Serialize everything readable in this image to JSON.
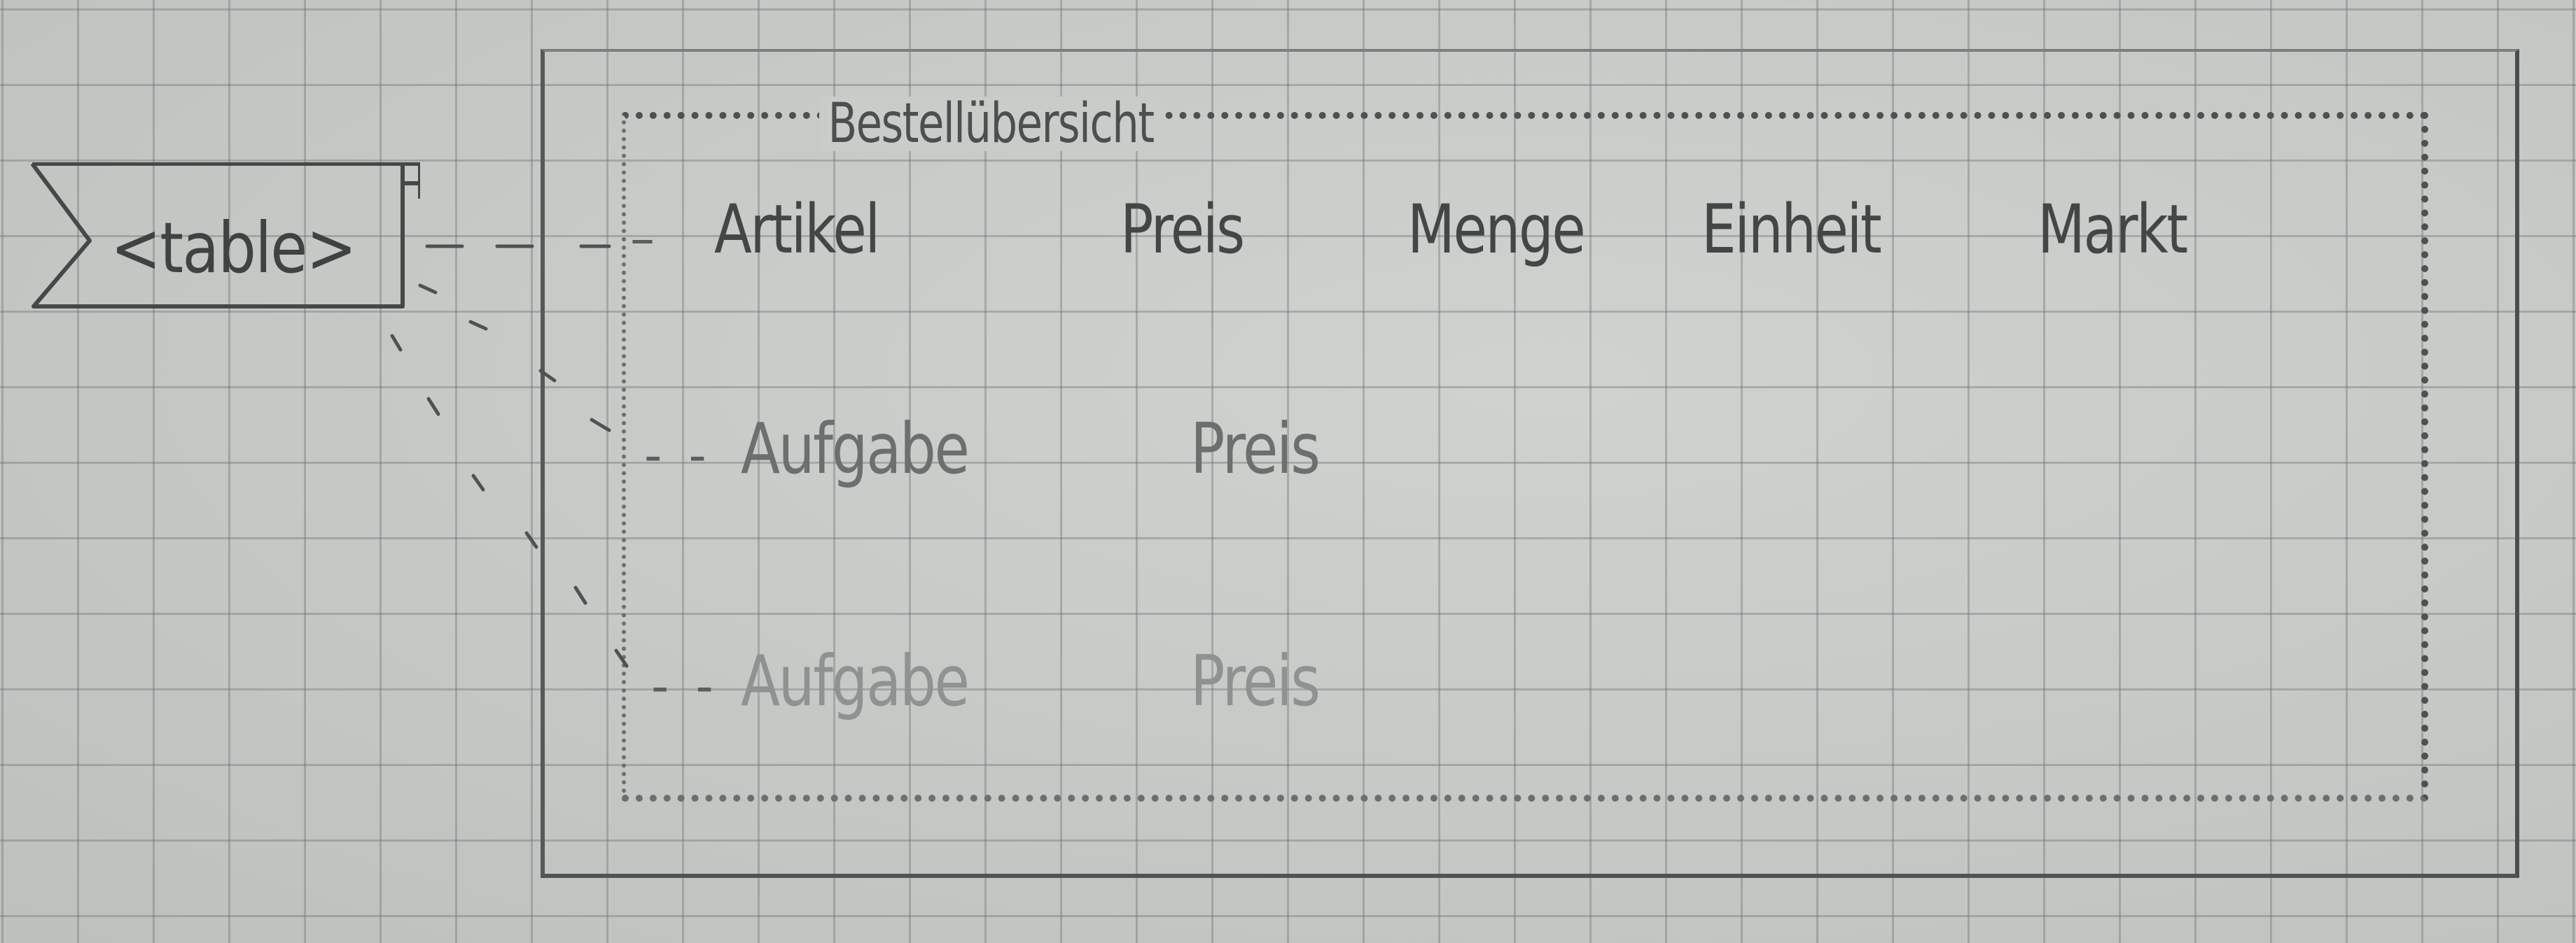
{
  "table_tag": "<table>",
  "table": {
    "caption": "Bestellübersicht",
    "headers": [
      "Artikel",
      "Preis",
      "Menge",
      "Einheit",
      "Markt"
    ],
    "rows": [
      [
        "Aufgabe",
        "Preis"
      ],
      [
        "Aufgabe",
        "Preis"
      ]
    ]
  },
  "colors": {
    "paper": "#c9ccc9",
    "grid": "#69706e",
    "pencil": "#424746"
  }
}
